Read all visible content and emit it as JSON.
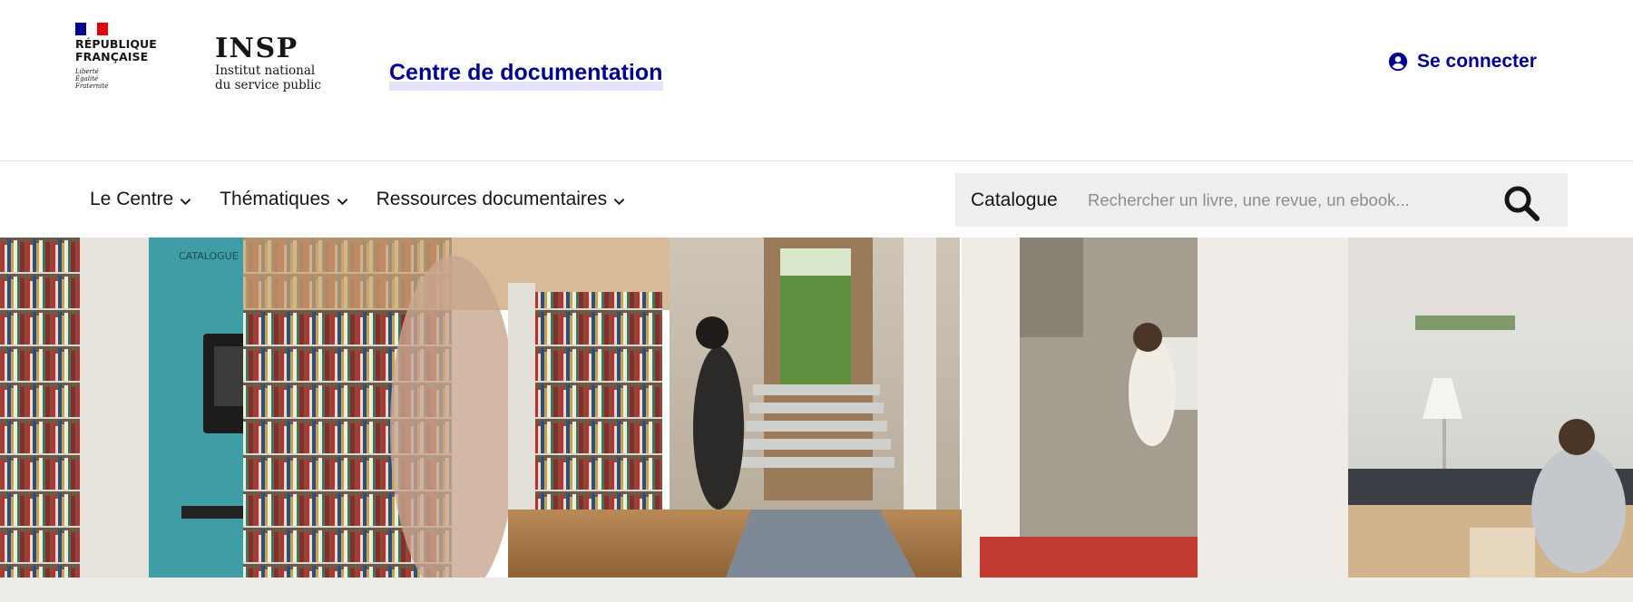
{
  "header": {
    "republic": {
      "name_line1": "RÉPUBLIQUE",
      "name_line2": "FRANÇAISE",
      "motto_1": "Liberté",
      "motto_2": "Égalité",
      "motto_3": "Fraternité",
      "flag_colors": [
        "#000091",
        "#ffffff",
        "#e1000f"
      ]
    },
    "insp": {
      "acronym": "INSP",
      "line1": "Institut national",
      "line2": "du service public"
    },
    "site_title": "Centre de documentation",
    "login_label": "Se connecter",
    "login_icon": "user-circle-icon"
  },
  "nav": {
    "items": [
      {
        "label": "Le Centre",
        "icon": "chevron-down-icon"
      },
      {
        "label": "Thématiques",
        "icon": "chevron-down-icon"
      },
      {
        "label": "Ressources documentaires",
        "icon": "chevron-down-icon"
      }
    ]
  },
  "search": {
    "scope": "Catalogue",
    "placeholder": "Rechercher un livre, une revue, un ebook...",
    "value": "",
    "button_icon": "search-icon"
  },
  "banner": {
    "catalogue_sign": "CATALOGUE"
  },
  "colors": {
    "accent": "#000091",
    "title_highlight": "#e3e3fd",
    "search_background": "#eeeeee",
    "text": "#161616"
  }
}
